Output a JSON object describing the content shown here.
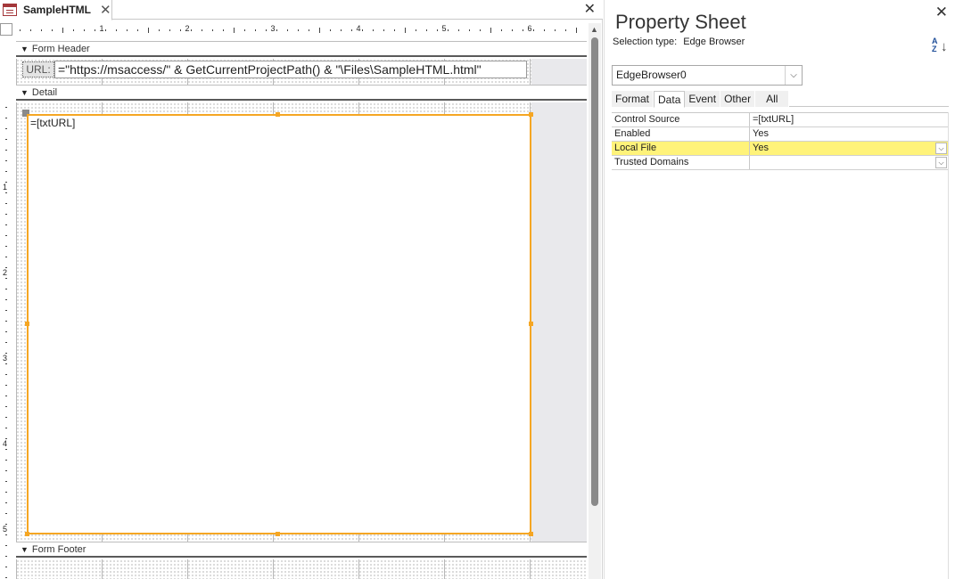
{
  "document": {
    "tab_label": "SampleHTML",
    "tab_close": "✕",
    "pane_close": "✕"
  },
  "ruler": {
    "horizontal_numbers": [
      "1",
      "2",
      "3",
      "4",
      "5",
      "6"
    ],
    "vertical_numbers": [
      "1",
      "2",
      "3",
      "4",
      "5"
    ]
  },
  "sections": {
    "form_header": "Form Header",
    "detail": "Detail",
    "form_footer": "Form Footer"
  },
  "header_controls": {
    "url_label": "URL:",
    "url_formula": "=\"https://msaccess/\" & GetCurrentProjectPath() & \"\\Files\\SampleHTML.html\""
  },
  "detail_controls": {
    "browser_source": "=[txtURL]"
  },
  "colors": {
    "selection_outline": "#f5a623",
    "selected_property_row": "#fff37a",
    "form_icon": "#a4373a"
  },
  "property_sheet": {
    "title": "Property Sheet",
    "close": "✕",
    "selection_type_label": "Selection type:",
    "selection_type_value": "Edge Browser",
    "selected_object": "EdgeBrowser0",
    "tabs": [
      "Format",
      "Data",
      "Event",
      "Other",
      "All"
    ],
    "active_tab": "Data",
    "properties": [
      {
        "name": "Control Source",
        "value": "=[txtURL]",
        "dropdown": false
      },
      {
        "name": "Enabled",
        "value": "Yes",
        "dropdown": false
      },
      {
        "name": "Local File",
        "value": "Yes",
        "dropdown": true,
        "selected": true
      },
      {
        "name": "Trusted Domains",
        "value": "",
        "dropdown": true
      }
    ]
  }
}
